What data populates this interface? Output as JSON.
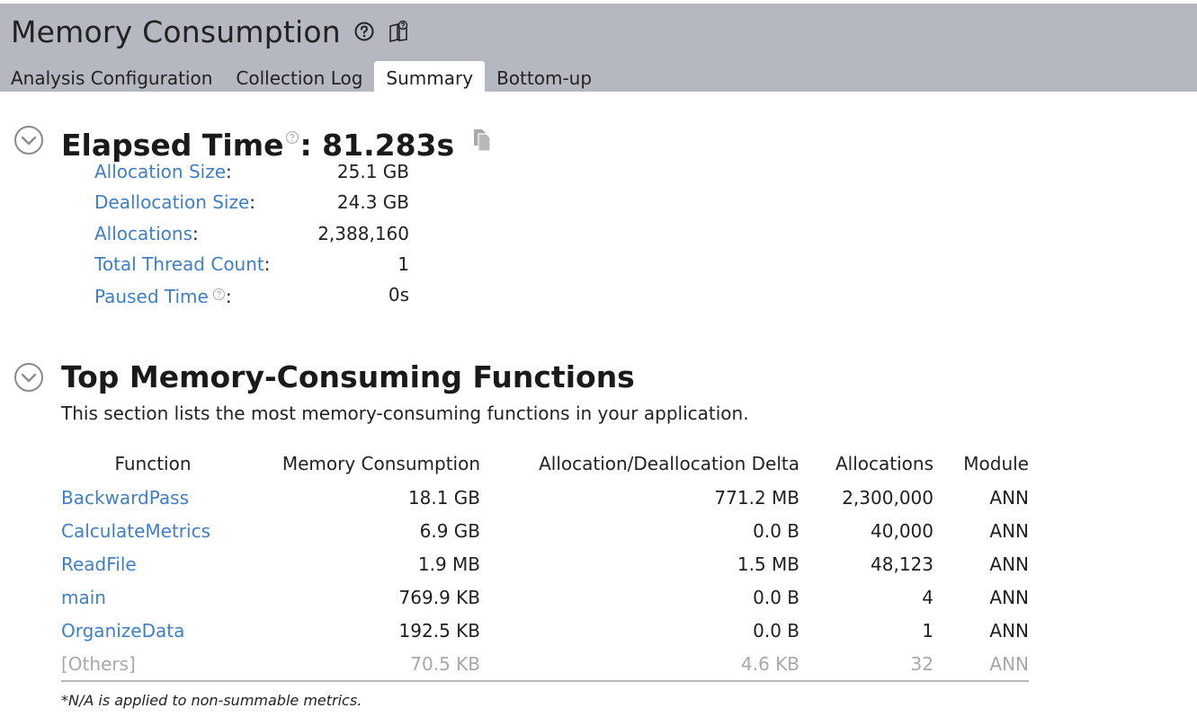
{
  "header": {
    "title": "Memory Consumption",
    "tabs": [
      {
        "label": "Analysis Configuration",
        "active": false
      },
      {
        "label": "Collection Log",
        "active": false
      },
      {
        "label": "Summary",
        "active": true
      },
      {
        "label": "Bottom-up",
        "active": false
      }
    ]
  },
  "elapsed": {
    "title_prefix": "Elapsed Time",
    "title_suffix": ": 81.283s",
    "metrics": [
      {
        "label": "Allocation Size",
        "value": "25.1 GB"
      },
      {
        "label": "Deallocation Size",
        "value": "24.3 GB"
      },
      {
        "label": "Allocations",
        "value": "2,388,160"
      },
      {
        "label": "Total Thread Count",
        "value": "1"
      },
      {
        "label": "Paused Time",
        "value": "0s"
      }
    ]
  },
  "top_functions": {
    "title": "Top Memory-Consuming Functions",
    "description": "This section lists the most memory-consuming functions in your application.",
    "columns": [
      "Function",
      "Memory Consumption",
      "Allocation/Deallocation Delta",
      "Allocations",
      "Module"
    ],
    "rows": [
      {
        "function": "BackwardPass",
        "memory": "18.1 GB",
        "delta": "771.2 MB",
        "allocations": "2,300,000",
        "module": "ANN"
      },
      {
        "function": "CalculateMetrics",
        "memory": "6.9 GB",
        "delta": "0.0 B",
        "allocations": "40,000",
        "module": "ANN"
      },
      {
        "function": "ReadFile",
        "memory": "1.9 MB",
        "delta": "1.5 MB",
        "allocations": "48,123",
        "module": "ANN"
      },
      {
        "function": "main",
        "memory": "769.9 KB",
        "delta": "0.0 B",
        "allocations": "4",
        "module": "ANN"
      },
      {
        "function": "OrganizeData",
        "memory": "192.5 KB",
        "delta": "0.0 B",
        "allocations": "1",
        "module": "ANN"
      },
      {
        "function": "[Others]",
        "memory": "70.5 KB",
        "delta": "4.6 KB",
        "allocations": "32",
        "module": "ANN"
      }
    ],
    "footnote": "*N/A is applied to non-summable metrics."
  },
  "colors": {
    "header_bg": "#b5b8c1",
    "link": "#3f7fc4",
    "muted": "#a8a8a8"
  }
}
